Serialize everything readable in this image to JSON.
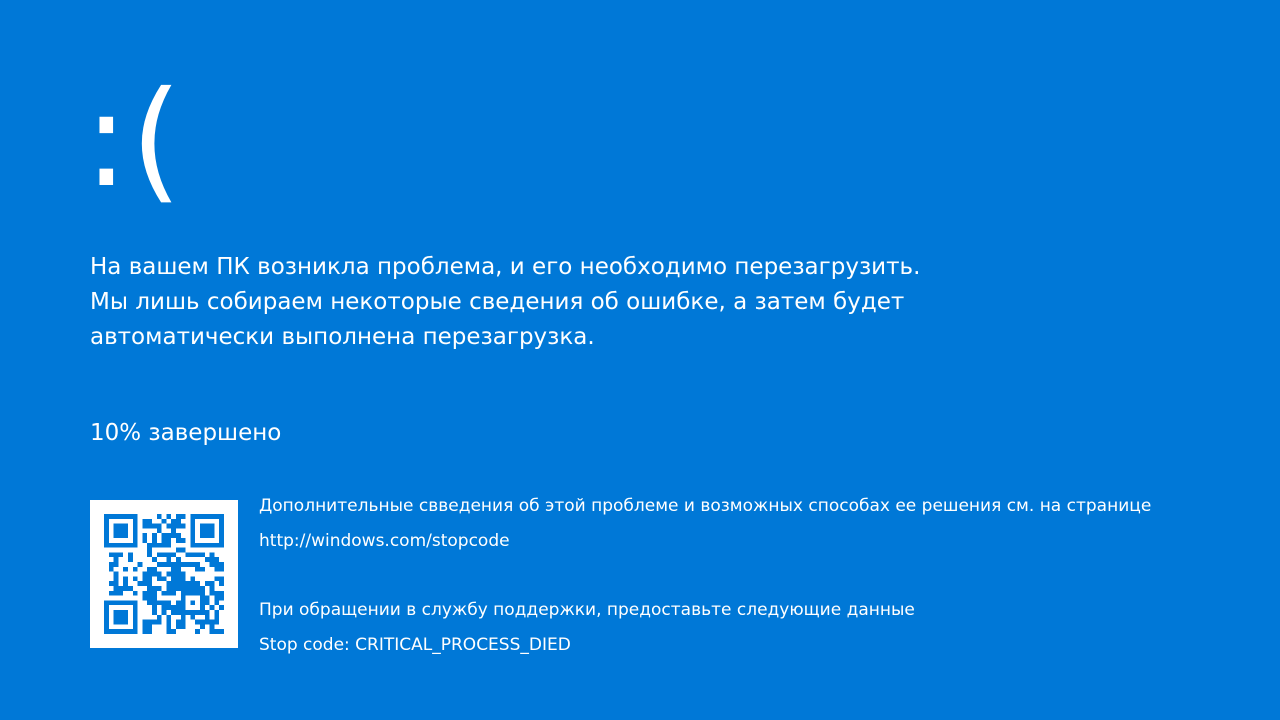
{
  "screen": {
    "background_color": "#0078d7",
    "text_color": "#ffffff"
  },
  "sad_face": ":(",
  "message": {
    "line1": "На вашем ПК возникла проблема, и его необходимо перезагрузить.",
    "line2": "Мы лишь собираем некоторые сведения об ошибке, а затем будет",
    "line3": "автоматически выполнена перезагрузка."
  },
  "progress": {
    "percent": 10,
    "text": "10% завершено"
  },
  "qr_code": {
    "icon": "qr-code-icon"
  },
  "info": {
    "more_info": "Дополнительные свведения об этой проблеме и возможных способах ее решения см. на странице",
    "url": "http://windows.com/stopcode",
    "support_text": "При обращении в службу поддержки, предоставьте следующие данные",
    "stop_code": "Stop code: CRITICAL_PROCESS_DIED"
  }
}
